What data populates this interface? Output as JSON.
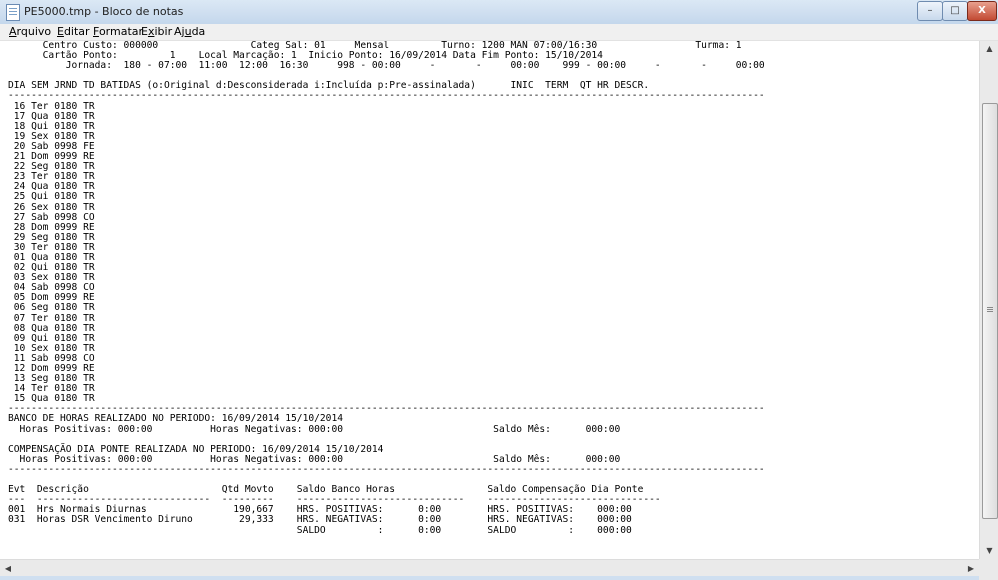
{
  "window": {
    "title": "PE5000.tmp - Bloco de notas",
    "controls": {
      "minimize": "–",
      "maximize": "□",
      "close": "X"
    }
  },
  "menu": {
    "items": [
      {
        "label": "Arquivo",
        "accel": "A"
      },
      {
        "label": "Editar",
        "accel": "E"
      },
      {
        "label": "Formatar",
        "accel": "F"
      },
      {
        "label": "Exibir",
        "accel": "x"
      },
      {
        "label": "Ajuda",
        "accel": "u"
      }
    ]
  },
  "document": {
    "lines": [
      "      Centro Custo: 000000                Categ Sal: 01     Mensal         Turno: 1200 MAN 07:00/16:30                 Turma: 1",
      "      Cartão Ponto:         1    Local Marcação: 1  Inicio Ponto: 16/09/2014 Data Fim Ponto: 15/10/2014",
      "          Jornada:  180 - 07:00  11:00  12:00  16:30     998 - 00:00     -       -     00:00    999 - 00:00     -       -     00:00",
      "",
      "DIA SEM JRND TD BATIDAS (o:Original d:Desconsiderada i:Incluída p:Pre-assinalada)      INIC  TERM  QT HR DESCR.",
      "-----------------------------------------------------------------------------------------------------------------------------------",
      " 16 Ter 0180 TR",
      " 17 Qua 0180 TR",
      " 18 Qui 0180 TR",
      " 19 Sex 0180 TR",
      " 20 Sab 0998 FE",
      " 21 Dom 0999 RE",
      " 22 Seg 0180 TR",
      " 23 Ter 0180 TR",
      " 24 Qua 0180 TR",
      " 25 Qui 0180 TR",
      " 26 Sex 0180 TR",
      " 27 Sab 0998 CO",
      " 28 Dom 0999 RE",
      " 29 Seg 0180 TR",
      " 30 Ter 0180 TR",
      " 01 Qua 0180 TR",
      " 02 Qui 0180 TR",
      " 03 Sex 0180 TR",
      " 04 Sab 0998 CO",
      " 05 Dom 0999 RE",
      " 06 Seg 0180 TR",
      " 07 Ter 0180 TR",
      " 08 Qua 0180 TR",
      " 09 Qui 0180 TR",
      " 10 Sex 0180 TR",
      " 11 Sab 0998 CO",
      " 12 Dom 0999 RE",
      " 13 Seg 0180 TR",
      " 14 Ter 0180 TR",
      " 15 Qua 0180 TR",
      "-----------------------------------------------------------------------------------------------------------------------------------",
      "BANCO DE HORAS REALIZADO NO PERIODO: 16/09/2014 15/10/2014",
      "  Horas Positivas: 000:00          Horas Negativas: 000:00                          Saldo Mês:      000:00",
      "",
      "COMPENSAÇÃO DIA PONTE REALIZADA NO PERIODO: 16/09/2014 15/10/2014",
      "  Horas Positivas: 000:00          Horas Negativas: 000:00                          Saldo Mês:      000:00",
      "-----------------------------------------------------------------------------------------------------------------------------------",
      "",
      "Evt  Descrição                       Qtd Movto    Saldo Banco Horas                Saldo Compensação Dia Ponte",
      "---  ------------------------------  ---------    -----------------------------    ------------------------------",
      "001  Hrs Normais Diurnas               190,667    HRS. POSITIVAS:      0:00        HRS. POSITIVAS:    000:00",
      "031  Horas DSR Vencimento Diruno        29,333    HRS. NEGATIVAS:      0:00        HRS. NEGATIVAS:    000:00",
      "                                                  SALDO         :      0:00        SALDO         :    000:00"
    ]
  },
  "scrollbars": {
    "up": "▲",
    "down": "▼",
    "left": "◀",
    "right": "▶"
  }
}
